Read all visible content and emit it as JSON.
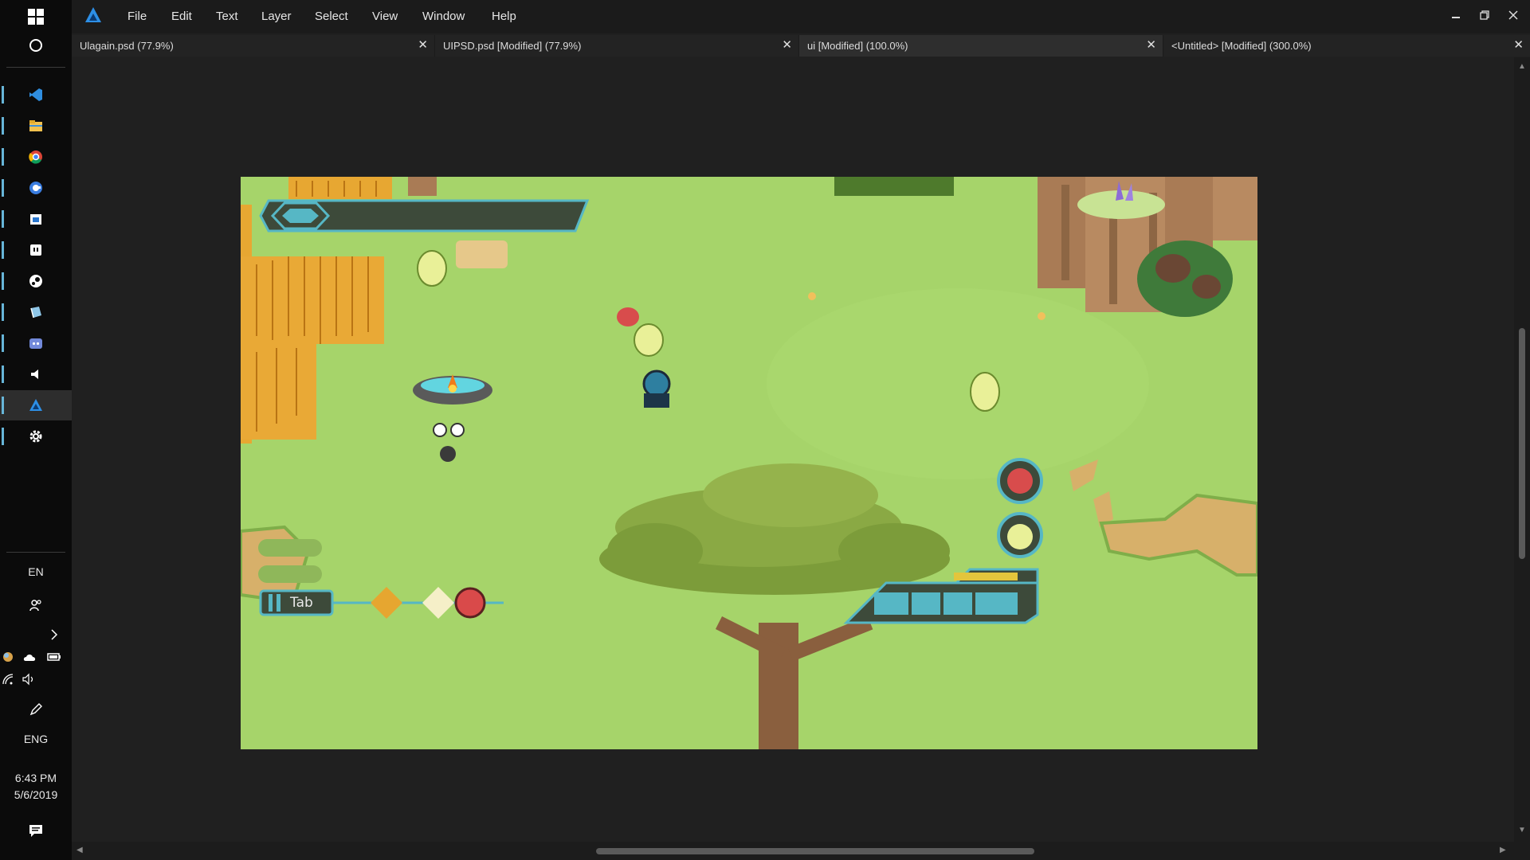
{
  "taskbar": {
    "language_short": "EN",
    "language_long": "ENG",
    "clock_time": "6:43 PM",
    "clock_date": "5/6/2019"
  },
  "menu": {
    "items": [
      "File",
      "Edit",
      "Text",
      "Layer",
      "Select",
      "View",
      "Window",
      "Help"
    ]
  },
  "tabs": [
    {
      "label": "Ulagain.psd (77.9%)",
      "close": "✕"
    },
    {
      "label": "UIPSD.psd [Modified] (77.9%)",
      "close": "✕"
    },
    {
      "label": "ui [Modified] (100.0%)",
      "close": "✕"
    },
    {
      "label": "<Untitled> [Modified] (300.0%)",
      "close": "✕"
    }
  ],
  "game_hud": {
    "tab_key_label": "Tab"
  },
  "colors": {
    "accent": "#67b5d8",
    "grass": "#a6d46a",
    "hud_teal": "#56b7c5",
    "hud_dark": "#3d4a3a"
  }
}
